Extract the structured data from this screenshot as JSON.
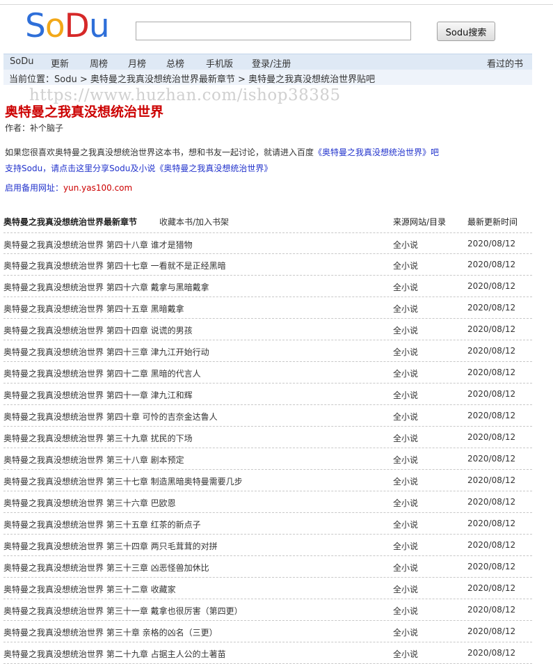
{
  "logo": {
    "letters": [
      "S",
      "o",
      "D",
      "u"
    ],
    "colors": [
      "#2e6fd9",
      "#f2a818",
      "#d62828",
      "#2e6fd9"
    ]
  },
  "search": {
    "value": "",
    "button": "Sodu搜索"
  },
  "nav": {
    "items": [
      "SoDu",
      "更新",
      "周榜",
      "月榜",
      "总榜",
      "手机版",
      "登录/注册"
    ],
    "right": "看过的书"
  },
  "breadcrumb": {
    "prefix": "当前位置：",
    "home": "Sodu",
    "sep1": " > ",
    "latest": "奥特曼之我真没想统治世界最新章节",
    "sep2": " > ",
    "tieba": "奥特曼之我真没想统治世界贴吧"
  },
  "watermark": "https://www.huzhan.com/ishop38385",
  "book": {
    "title": "奥特曼之我真没想统治世界",
    "author": "作者：补个脑子"
  },
  "intro": {
    "line1_prefix": "如果您很喜欢奥特曼之我真没想统治世界这本书，想和书友一起讨论，就请进入百度",
    "line1_link": "《奥特曼之我真没想统治世界》吧",
    "line2": "支持Sodu，请点击这里分享Sodu及小说《奥特曼之我真没想统治世界》",
    "line3_label": "启用备用网址：",
    "line3_url": "yun.yas100.com"
  },
  "table": {
    "header_title": "奥特曼之我真没想统治世界最新章节",
    "header_fav": "收藏本书/加入书架",
    "header_source": "来源网站/目录",
    "header_time": "最新更新时间",
    "rows": [
      {
        "title": "奥特曼之我真没想统治世界 第四十八章 谁才是猎物",
        "source": "全小说",
        "date": "2020/08/12"
      },
      {
        "title": "奥特曼之我真没想统治世界 第四十七章 一看就不是正经黑暗",
        "source": "全小说",
        "date": "2020/08/12"
      },
      {
        "title": "奥特曼之我真没想统治世界 第四十六章 戴拿与黑暗戴拿",
        "source": "全小说",
        "date": "2020/08/12"
      },
      {
        "title": "奥特曼之我真没想统治世界 第四十五章 黑暗戴拿",
        "source": "全小说",
        "date": "2020/08/12"
      },
      {
        "title": "奥特曼之我真没想统治世界 第四十四章 说谎的男孩",
        "source": "全小说",
        "date": "2020/08/12"
      },
      {
        "title": "奥特曼之我真没想统治世界 第四十三章 津九江开始行动",
        "source": "全小说",
        "date": "2020/08/12"
      },
      {
        "title": "奥特曼之我真没想统治世界 第四十二章 黑暗的代言人",
        "source": "全小说",
        "date": "2020/08/12"
      },
      {
        "title": "奥特曼之我真没想统治世界 第四十一章 津九江和辉",
        "source": "全小说",
        "date": "2020/08/12"
      },
      {
        "title": "奥特曼之我真没想统治世界 第四十章 可怜的吉奈金达鲁人",
        "source": "全小说",
        "date": "2020/08/12"
      },
      {
        "title": "奥特曼之我真没想统治世界 第三十九章 扰民的下场",
        "source": "全小说",
        "date": "2020/08/12"
      },
      {
        "title": "奥特曼之我真没想统治世界 第三十八章 剧本预定",
        "source": "全小说",
        "date": "2020/08/12"
      },
      {
        "title": "奥特曼之我真没想统治世界 第三十七章 制造黑暗奥特曼需要几步",
        "source": "全小说",
        "date": "2020/08/12"
      },
      {
        "title": "奥特曼之我真没想统治世界 第三十六章 巴欧恩",
        "source": "全小说",
        "date": "2020/08/12"
      },
      {
        "title": "奥特曼之我真没想统治世界 第三十五章 红茶的新点子",
        "source": "全小说",
        "date": "2020/08/12"
      },
      {
        "title": "奥特曼之我真没想统治世界 第三十四章 两只毛茸茸的对拼",
        "source": "全小说",
        "date": "2020/08/12"
      },
      {
        "title": "奥特曼之我真没想统治世界 第三十三章 凶恶怪兽加休比",
        "source": "全小说",
        "date": "2020/08/12"
      },
      {
        "title": "奥特曼之我真没想统治世界 第三十二章 收藏家",
        "source": "全小说",
        "date": "2020/08/12"
      },
      {
        "title": "奥特曼之我真没想统治世界 第三十一章 戴拿也很厉害（第四更）",
        "source": "全小说",
        "date": "2020/08/12"
      },
      {
        "title": "奥特曼之我真没想统治世界 第三十章 亲格的凶名（三更）",
        "source": "全小说",
        "date": "2020/08/12"
      },
      {
        "title": "奥特曼之我真没想统治世界 第二十九章 占据主人公的土著苗",
        "source": "全小说",
        "date": "2020/08/12"
      }
    ]
  }
}
